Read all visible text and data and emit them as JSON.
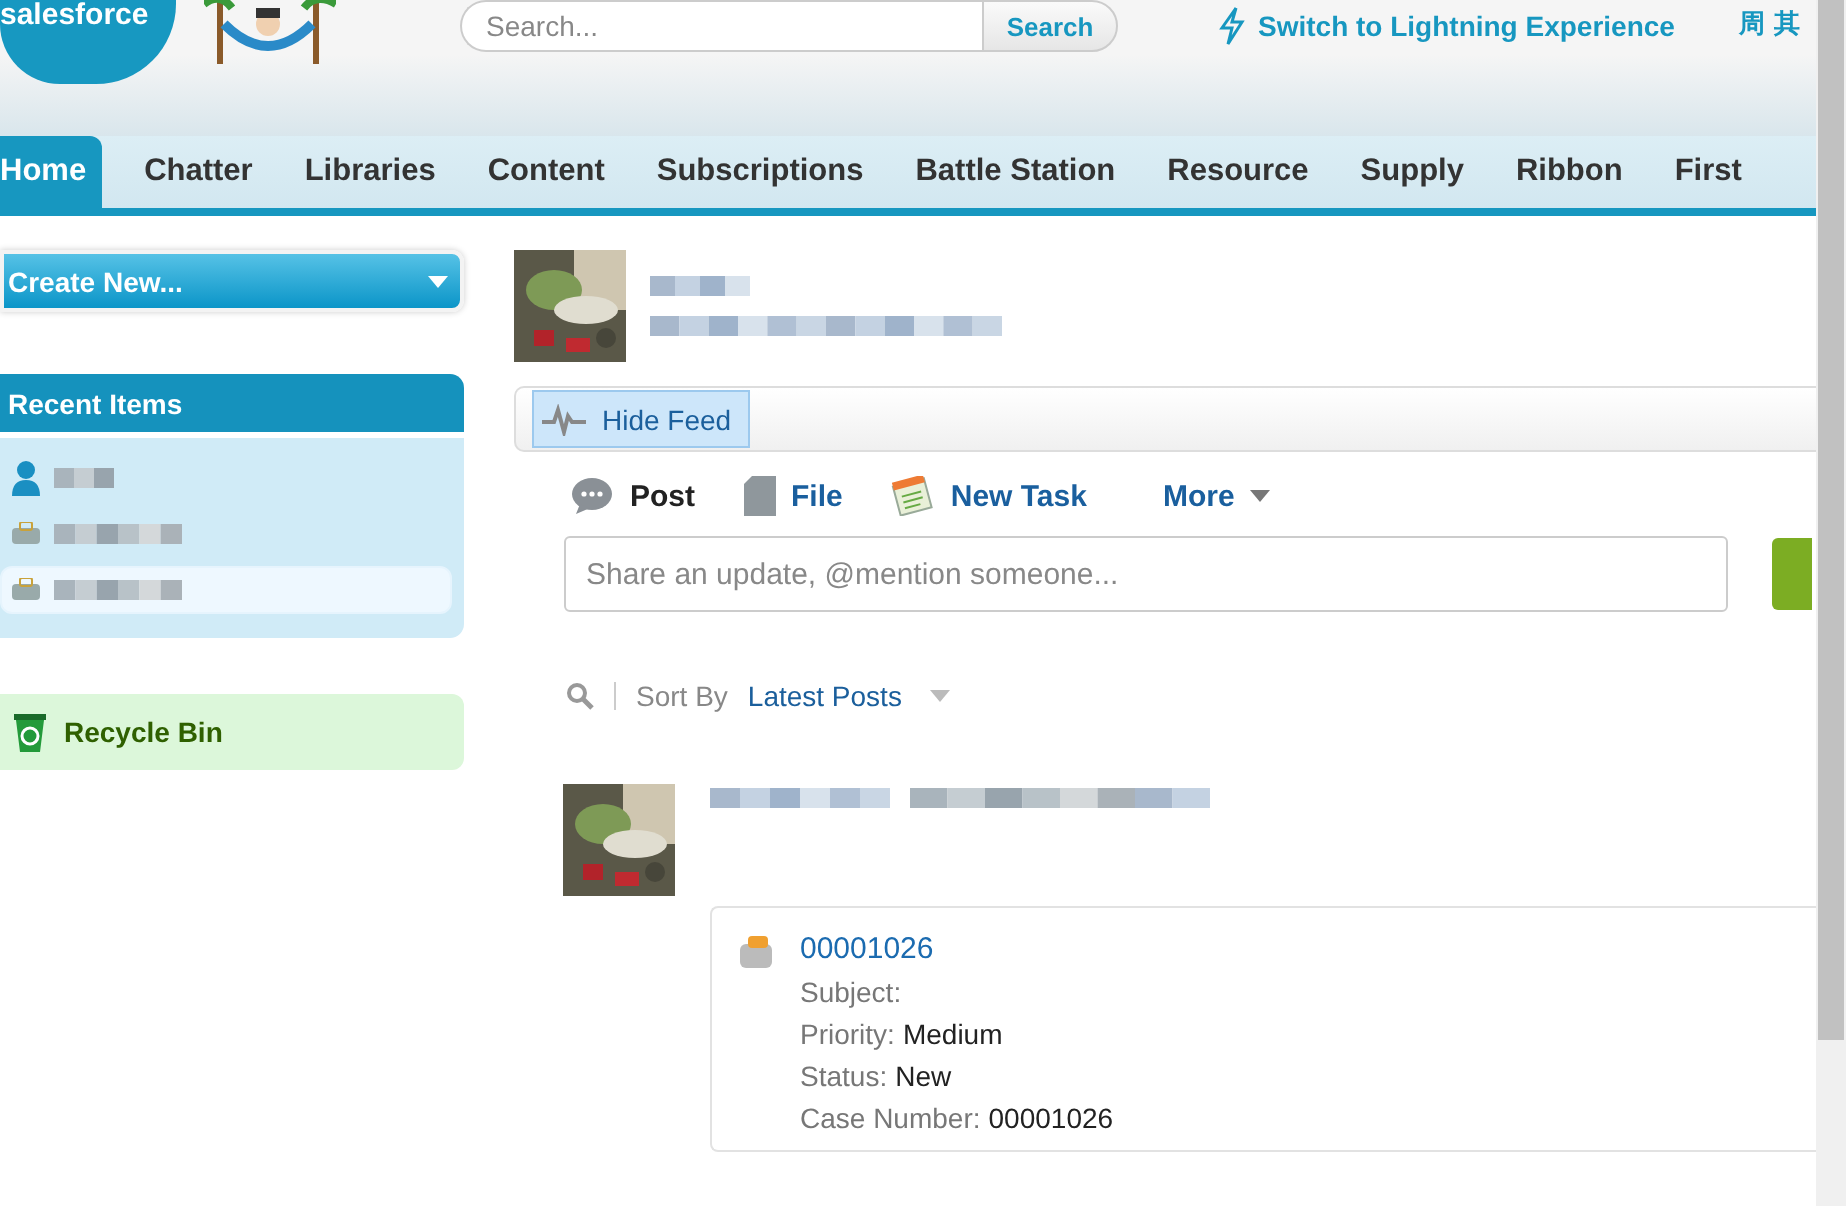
{
  "header": {
    "logo": "salesforce",
    "search": {
      "placeholder": "Search...",
      "button": "Search"
    },
    "lightning_link": "Switch to Lightning Experience",
    "user_menu": "周 其"
  },
  "tabs": [
    {
      "label": "Home",
      "selected": true
    },
    {
      "label": "Chatter",
      "selected": false
    },
    {
      "label": "Libraries",
      "selected": false
    },
    {
      "label": "Content",
      "selected": false
    },
    {
      "label": "Subscriptions",
      "selected": false
    },
    {
      "label": "Battle Station",
      "selected": false
    },
    {
      "label": "Resource",
      "selected": false
    },
    {
      "label": "Supply",
      "selected": false
    },
    {
      "label": "Ribbon",
      "selected": false
    },
    {
      "label": "First",
      "selected": false
    }
  ],
  "sidebar": {
    "create_new": "Create New...",
    "recent_items": {
      "title": "Recent Items",
      "items": [
        {
          "kind": "person",
          "highlighted": false
        },
        {
          "kind": "case",
          "highlighted": false
        },
        {
          "kind": "case",
          "highlighted": true
        }
      ]
    },
    "recycle_bin": "Recycle Bin"
  },
  "feed_toggle": "Hide Feed",
  "publisher": {
    "actions": [
      {
        "label": "Post",
        "selected": true,
        "kind": "post"
      },
      {
        "label": "File",
        "selected": false,
        "kind": "file"
      },
      {
        "label": "New Task",
        "selected": false,
        "kind": "task"
      },
      {
        "label": "More",
        "selected": false,
        "kind": "more"
      }
    ],
    "placeholder": "Share an update, @mention someone..."
  },
  "sort": {
    "label": "Sort By",
    "value": "Latest Posts"
  },
  "feed_item": {
    "case": {
      "link": "00001026",
      "fields": [
        {
          "label": "Subject:"
        },
        {
          "label": "Priority:",
          "value": "Medium"
        },
        {
          "label": "Status:",
          "value": "New"
        },
        {
          "label": "Case Number:",
          "value": "00001026"
        }
      ]
    }
  }
}
